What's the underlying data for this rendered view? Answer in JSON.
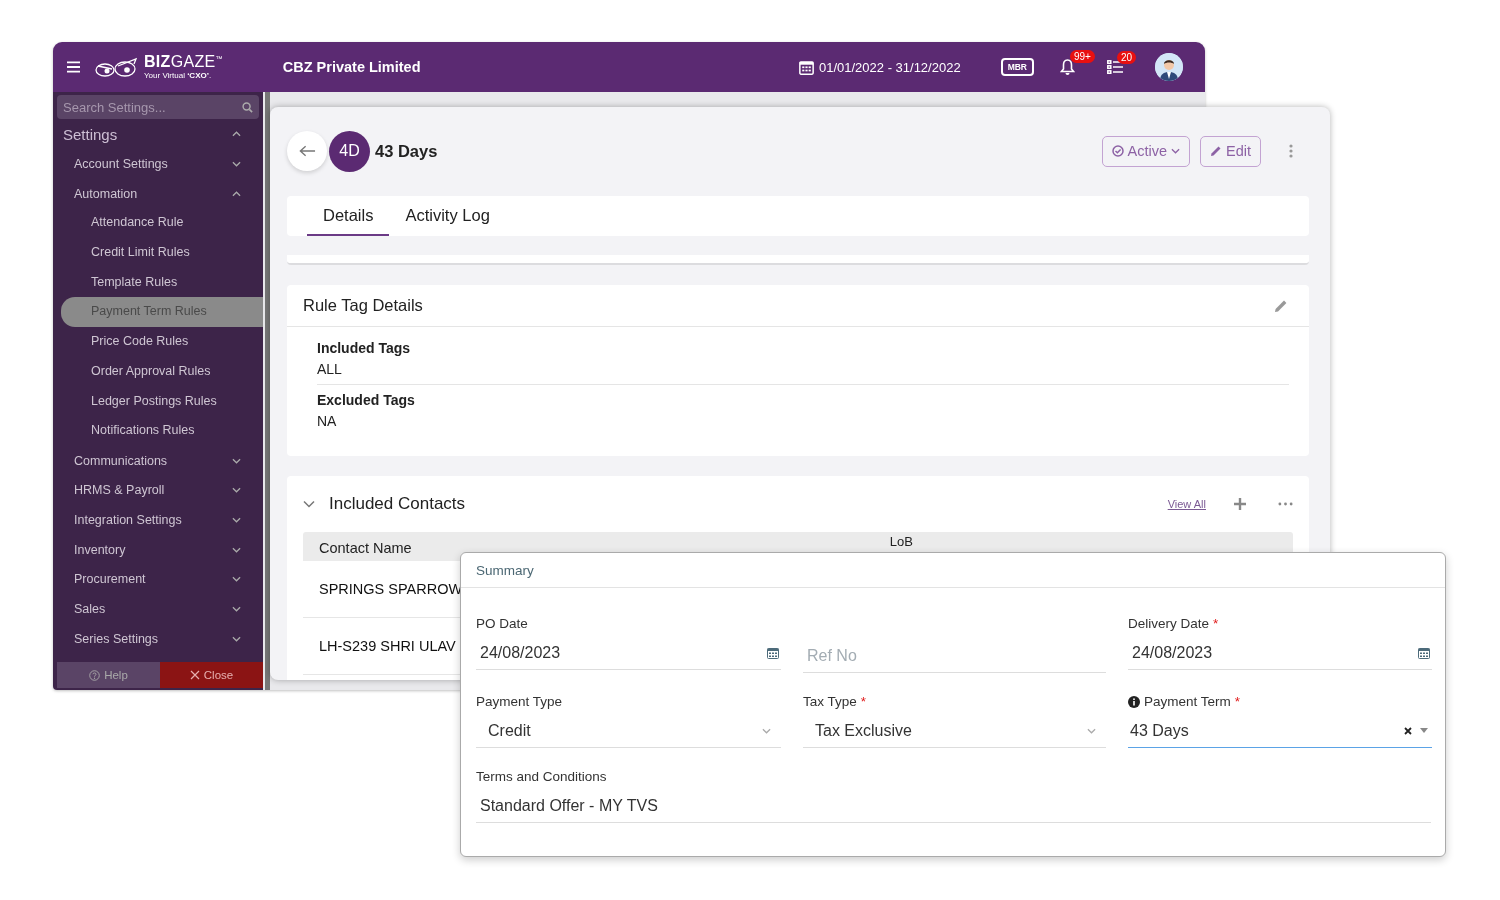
{
  "header": {
    "logo": "**BIZ**GAZE$^{™}$",
    "tagline": "Your Virtual **‘CXO’**.",
    "company": "CBZ Private Limited",
    "date_range": "01/01/2022 - 31/12/2022",
    "branch_badge": "MBR",
    "notifications_count": "99+",
    "tasks_count": "20"
  },
  "sidebar": {
    "search_placeholder": "Search Settings...",
    "title": "Settings",
    "expanded": true,
    "items": [
      {
        "label": "Account Settings",
        "expanded": false
      },
      {
        "label": "Automation",
        "expanded": true,
        "children": [
          {
            "label": "Attendance Rule",
            "selected": false
          },
          {
            "label": "Credit Limit Rules",
            "selected": false
          },
          {
            "label": "Template Rules",
            "selected": false
          },
          {
            "label": "Payment Term Rules",
            "selected": true
          },
          {
            "label": "Price Code Rules",
            "selected": false
          },
          {
            "label": "Order Approval Rules",
            "selected": false
          },
          {
            "label": "Ledger Postings Rules",
            "selected": false
          },
          {
            "label": "Notifications Rules",
            "selected": false
          }
        ]
      },
      {
        "label": "Communications",
        "expanded": false
      },
      {
        "label": "HRMS & Payroll",
        "expanded": false
      },
      {
        "label": "Integration Settings",
        "expanded": false
      },
      {
        "label": "Inventory",
        "expanded": false
      },
      {
        "label": "Procurement",
        "expanded": false
      },
      {
        "label": "Sales",
        "expanded": false
      },
      {
        "label": "Series Settings",
        "expanded": false
      }
    ],
    "footer_buttons": [
      {
        "label": "Help",
        "kind": "help"
      },
      {
        "label": "Close",
        "kind": "close"
      }
    ]
  },
  "record": {
    "avatar": "4D",
    "title": "43 Days",
    "status": "Active",
    "edit": "Edit",
    "tabs": [
      {
        "label": "Details",
        "selected": true
      },
      {
        "label": "Activity Log",
        "selected": false
      }
    ],
    "rule_tags": {
      "title": "Rule Tag Details",
      "fields": [
        {
          "label": "Included Tags",
          "value": "ALL"
        },
        {
          "label": "Excluded Tags",
          "value": "NA"
        }
      ]
    },
    "contacts": {
      "title": "Included Contacts",
      "expanded": true,
      "view_all": "View All",
      "columns": [
        "Contact Name",
        "LoB"
      ],
      "rows": [
        [
          "SPRINGS SPARROW"
        ],
        [
          "LH-S239 SHRI ULAV"
        ]
      ]
    }
  },
  "summary": {
    "title": "Summary",
    "fields": [
      {
        "kind": "date",
        "label": "PO Date",
        "value": "24/08/2023",
        "info": false,
        "focused": false
      },
      {
        "kind": "text",
        "placeholder": "Ref No",
        "info": false,
        "focused": false
      },
      {
        "kind": "date",
        "label": "Delivery Date",
        "required_mark": "*",
        "value": "24/08/2023",
        "info": false,
        "focused": false
      },
      {
        "kind": "select",
        "label": "Payment Type",
        "value": "Credit",
        "info": false,
        "focused": false
      },
      {
        "kind": "select",
        "label": "Tax Type",
        "required_mark": "*",
        "value": "Tax Exclusive",
        "info": false,
        "focused": false
      },
      {
        "kind": "combo",
        "label": "Payment Term",
        "required_mark": "*",
        "value": "43 Days",
        "info": true,
        "focused": true
      }
    ],
    "terms": {
      "label": "Terms and Conditions",
      "value": "Standard Offer - MY TVS"
    }
  }
}
